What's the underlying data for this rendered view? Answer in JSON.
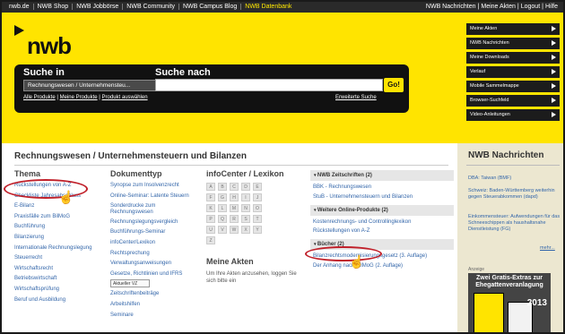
{
  "topbar": {
    "left": [
      "nwb.de",
      "NWB Shop",
      "NWB Jobbörse",
      "NWB Community",
      "NWB Campus Blog",
      "NWB Datenbank"
    ],
    "right": [
      "NWB Nachrichten",
      "Meine Akten",
      "Logout",
      "Hilfe"
    ]
  },
  "logo": {
    "text": "nwb"
  },
  "search": {
    "in_label": "Suche in",
    "nach_label": "Suche nach",
    "scope_value": "Rechnungswesen / Unternehmensteu...",
    "go_label": "Go!",
    "links": [
      "Alle Produkte",
      "Meine Produkte",
      "Produkt auswählen"
    ],
    "advanced": "Erweiterte Suche"
  },
  "quick_links": [
    "Meine Akten",
    "NWB Nachrichten",
    "Meine Downloads",
    "Verlauf",
    "Mobile Sammelmappe",
    "Browser-Suchfeld",
    "Video-Anleitungen"
  ],
  "page_title": "Rechnungswesen / Unternehmensteuern und Bilanzen",
  "thema": {
    "heading": "Thema",
    "items": [
      "Rückstellungen von A-Z",
      "Checkliste Jahresabschluss",
      "E-Bilanz",
      "Praxisfälle zum BilMoG",
      "Buchführung",
      "Bilanzierung",
      "Internationale Rechnungslegung",
      "Steuerrecht",
      "Wirtschaftsrecht",
      "Betriebswirtschaft",
      "Wirtschaftsprüfung",
      "Beruf und Ausbildung"
    ]
  },
  "dokumenttyp": {
    "heading": "Dokumenttyp",
    "items": [
      "Synopse zum Insolvenzrecht",
      "Online-Seminar: Latente Steuern",
      "Sonderdrucke zum Rechnungswesen",
      "Rechnungslegungsvergleich",
      "Buchführungs-Seminar",
      "infoCenter/Lexikon",
      "Rechtsprechung",
      "Verwaltungsanweisungen",
      "Gesetze, Richtlinien und IFRS"
    ],
    "select_value": "Aktueller VZ",
    "items_after": [
      "Zeitschriftenbeiträge",
      "Arbeitshilfen",
      "Seminare"
    ]
  },
  "infocenter": {
    "heading": "infoCenter / Lexikon",
    "letters": [
      "A",
      "B",
      "C",
      "D",
      "E",
      "F",
      "G",
      "H",
      "I",
      "J",
      "K",
      "L",
      "M",
      "N",
      "O",
      "P",
      "Q",
      "R",
      "S",
      "T",
      "U",
      "V",
      "W",
      "X",
      "Y",
      "Z"
    ]
  },
  "meine_akten": {
    "heading": "Meine Akten",
    "text": "Um Ihre Akten anzusehen, loggen Sie sich bitte ein"
  },
  "zeitschriften": {
    "heading": "NWB Zeitschriften (2)",
    "items": [
      "BBK - Rechnungswesen",
      "StuB - Unternehmensteuern und Bilanzen"
    ]
  },
  "weitere": {
    "heading": "Weitere Online-Produkte (2)",
    "items": [
      "Kostenrechnungs- und Controllinglexikon",
      "Rückstellungen von A-Z"
    ]
  },
  "buecher": {
    "heading": "Bücher (2)",
    "items": [
      "Bilanzrechtsmodernisierungsgesetz (3. Auflage)",
      "Der Anhang nach BilMoG (2. Auflage)"
    ]
  },
  "nachrichten": {
    "heading": "NWB Nachrichten",
    "items": [
      "DBA: Taiwan (BMF)",
      "Schweiz: Baden-Württemberg weiterhin gegen Steuerabkommen (dapd)",
      "Einkommensteuer: Aufwendungen für das Schneeschippen als haushaltsnahe Dienstleistung (FG)"
    ],
    "more": "mehr..."
  },
  "ad": {
    "label": "Anzeige",
    "title": "Zwei Gratis-Extras zur Ehegattenveranlagung",
    "year": "2013"
  },
  "colors": {
    "brand_yellow": "#ffe400",
    "dark": "#111111",
    "link": "#3366aa",
    "highlight": "#c0202a"
  }
}
